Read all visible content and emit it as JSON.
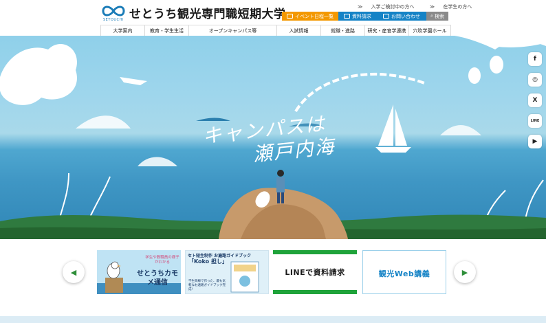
{
  "header": {
    "logo_brand": "SETOUCHI",
    "school_name": "せとうち観光専門職短期大学",
    "top_links": [
      "入学ご検討中の方へ",
      "在学生の方へ"
    ],
    "utility": {
      "event": "イベント日程一覧",
      "brochure": "資料請求",
      "inquiry": "お問い合わせ",
      "search": "検索"
    },
    "nav": [
      "大学案内",
      "教育・学生生活",
      "オープンキャンパス等",
      "入試情報",
      "就職・進路",
      "研究・産官学連携",
      "穴吹学園ホール"
    ]
  },
  "hero": {
    "copy_line1": "キャンパスは",
    "copy_line2": "瀬戸内海"
  },
  "social": [
    {
      "icon": "facebook-icon",
      "glyph": "f"
    },
    {
      "icon": "instagram-icon",
      "glyph": "◎"
    },
    {
      "icon": "x-icon",
      "glyph": "X"
    },
    {
      "icon": "line-icon",
      "glyph": "LINE"
    },
    {
      "icon": "youtube-icon",
      "glyph": "▶"
    }
  ],
  "banners": {
    "kamome": {
      "small": "学生や教職員の様子がわかる",
      "title": "せとうちカモメ通信"
    },
    "koko": {
      "title": "セト短生制作 お遍路ガイドブック",
      "koko": "「Koko 担し」",
      "note": "学生目線で作った、最も気軽なお遍路ガイドブック完成!"
    },
    "line": {
      "text": "LINEで資料請求"
    },
    "web": {
      "text": "観光Web講義"
    }
  },
  "colors": {
    "event": "#f39800",
    "brand_blue": "#1583c6",
    "line_green": "#1fa33a",
    "search_gray": "#8a8a8a"
  }
}
